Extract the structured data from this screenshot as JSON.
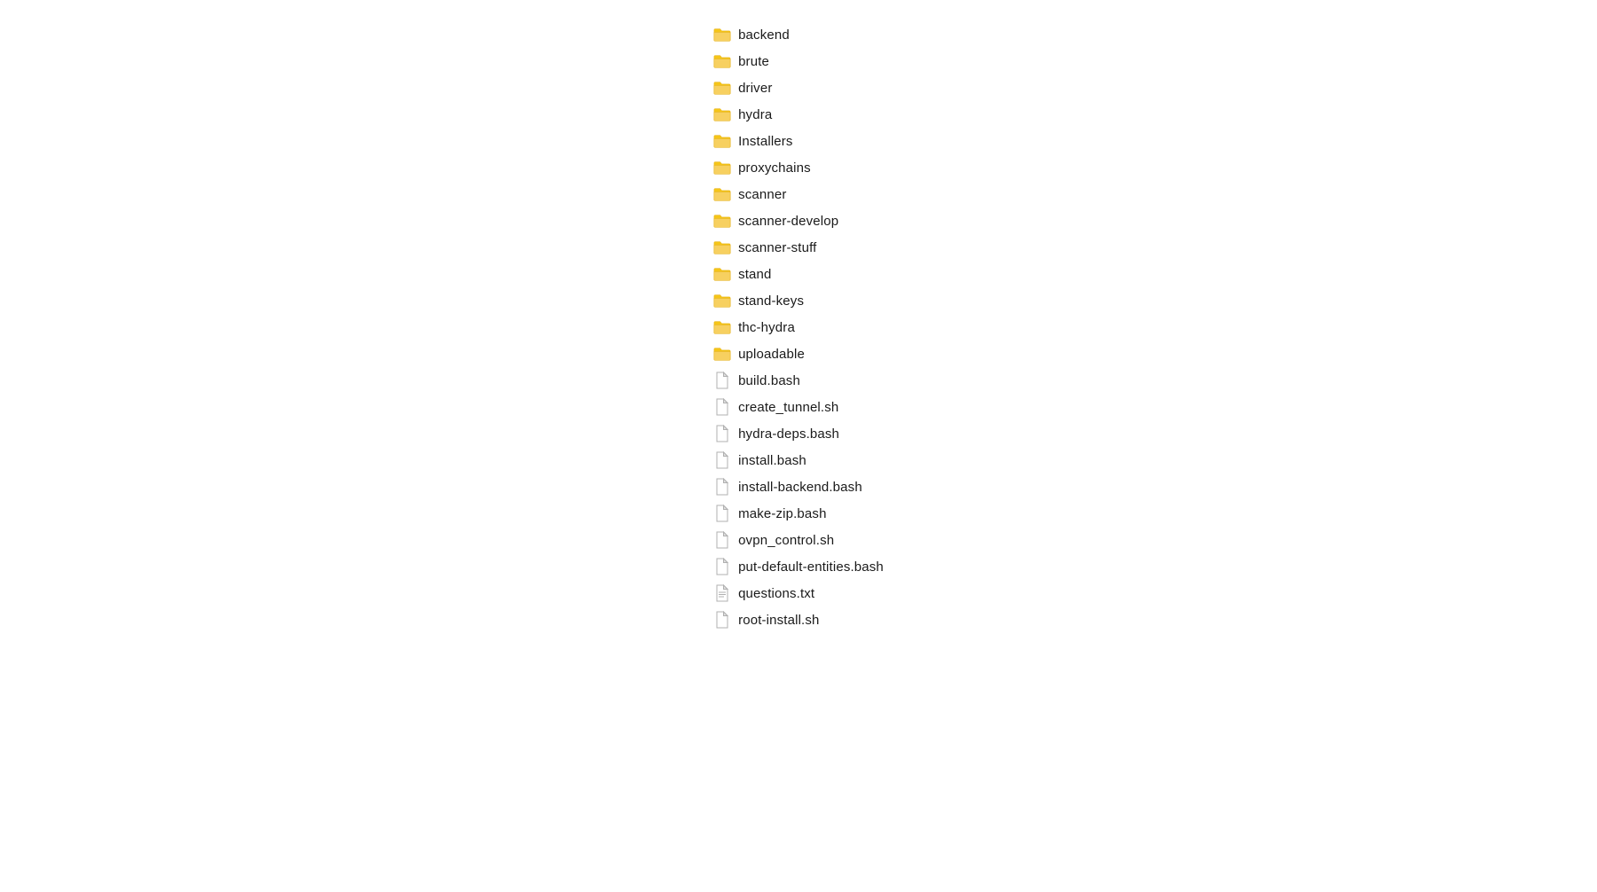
{
  "items": [
    {
      "name": "backend",
      "type": "folder"
    },
    {
      "name": "brute",
      "type": "folder"
    },
    {
      "name": "driver",
      "type": "folder"
    },
    {
      "name": "hydra",
      "type": "folder"
    },
    {
      "name": "Installers",
      "type": "folder"
    },
    {
      "name": "proxychains",
      "type": "folder"
    },
    {
      "name": "scanner",
      "type": "folder"
    },
    {
      "name": "scanner-develop",
      "type": "folder"
    },
    {
      "name": "scanner-stuff",
      "type": "folder"
    },
    {
      "name": "stand",
      "type": "folder"
    },
    {
      "name": "stand-keys",
      "type": "folder"
    },
    {
      "name": "thc-hydra",
      "type": "folder"
    },
    {
      "name": "uploadable",
      "type": "folder"
    },
    {
      "name": "build.bash",
      "type": "file"
    },
    {
      "name": "create_tunnel.sh",
      "type": "file"
    },
    {
      "name": "hydra-deps.bash",
      "type": "file"
    },
    {
      "name": "install.bash",
      "type": "file"
    },
    {
      "name": "install-backend.bash",
      "type": "file"
    },
    {
      "name": "make-zip.bash",
      "type": "file"
    },
    {
      "name": "ovpn_control.sh",
      "type": "file"
    },
    {
      "name": "put-default-entities.bash",
      "type": "file"
    },
    {
      "name": "questions.txt",
      "type": "file-lines"
    },
    {
      "name": "root-install.sh",
      "type": "file"
    }
  ],
  "colors": {
    "folder": "#f5c518",
    "folder_dark": "#e6a800",
    "file": "#a0a0a0",
    "file_lines": "#888888"
  }
}
